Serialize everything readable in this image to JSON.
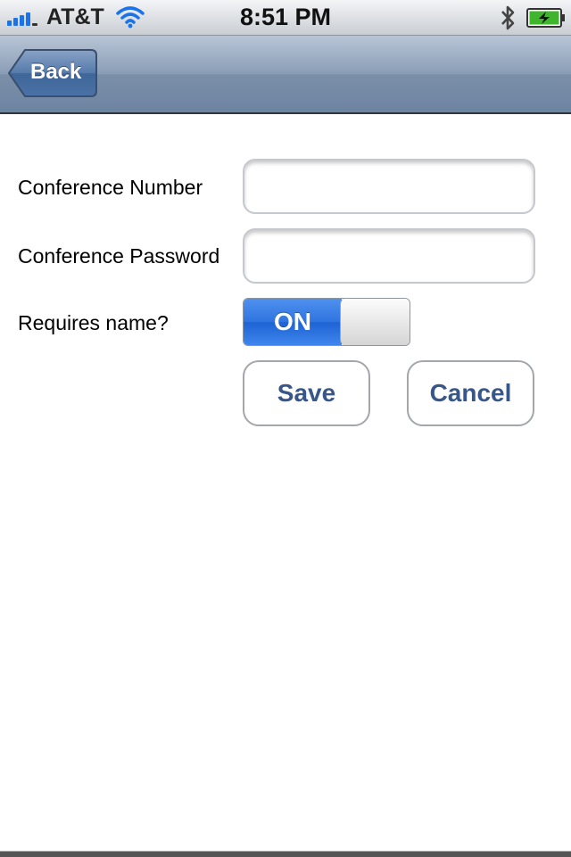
{
  "status_bar": {
    "carrier": "AT&T",
    "time": "8:51 PM",
    "battery_level": 1.0
  },
  "nav": {
    "back_label": "Back"
  },
  "form": {
    "conference_number_label": "Conference Number",
    "conference_number_value": "",
    "conference_password_label": "Conference Password",
    "conference_password_value": "",
    "requires_name_label": "Requires name?",
    "requires_name_switch": "ON",
    "save_label": "Save",
    "cancel_label": "Cancel"
  },
  "colors": {
    "nav_bar": "#7b8fa9",
    "switch_on": "#2f74e0",
    "button_text": "#37568a"
  }
}
